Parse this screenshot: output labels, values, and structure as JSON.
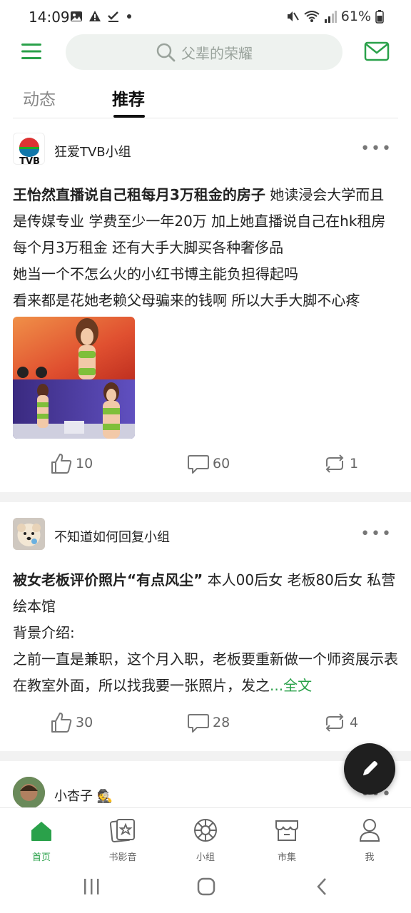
{
  "status_bar": {
    "time": "14:09",
    "battery": "61%"
  },
  "search": {
    "placeholder": "父辈的荣耀"
  },
  "tabs": [
    {
      "label": "动态"
    },
    {
      "label": "推荐"
    }
  ],
  "posts": [
    {
      "group": "狂爱TVB小组",
      "avatar_text": "TVB",
      "title": "王怡然直播说自己租每月3万租金的房子",
      "body": "她读浸会大学而且是传媒专业 学费至少一年20万 加上她直播说自己在hk租房每个月3万租金 还有大手大脚买各种奢侈品",
      "line2": "她当一个不怎么火的小红书博主能负担得起吗",
      "line3": "看来都是花她老赖父母骗来的钱啊 所以大手大脚不心疼",
      "likes": "10",
      "comments": "60",
      "reposts": "1"
    },
    {
      "group": "不知道如何回复小组",
      "title": "被女老板评价照片“有点风尘”",
      "body": "本人00后女 老板80后女 私营绘本馆",
      "line2": "背景介绍:",
      "line3": "之前一直是兼职，这个月入职，老板要重新做一个师资展示表在教室外面，所以找我要一张照片，发之",
      "more_link": "...全文",
      "likes": "30",
      "comments": "28",
      "reposts": "4"
    },
    {
      "group": "小杏子"
    }
  ],
  "bottom_nav": [
    {
      "label": "首页",
      "icon": "home-icon"
    },
    {
      "label": "书影音",
      "icon": "media-icon"
    },
    {
      "label": "小组",
      "icon": "group-icon"
    },
    {
      "label": "市集",
      "icon": "market-icon"
    },
    {
      "label": "我",
      "icon": "profile-icon"
    }
  ],
  "colors": {
    "accent": "#2aa14a",
    "search_bg": "#eef2ef",
    "divider": "#f2f2f2"
  }
}
